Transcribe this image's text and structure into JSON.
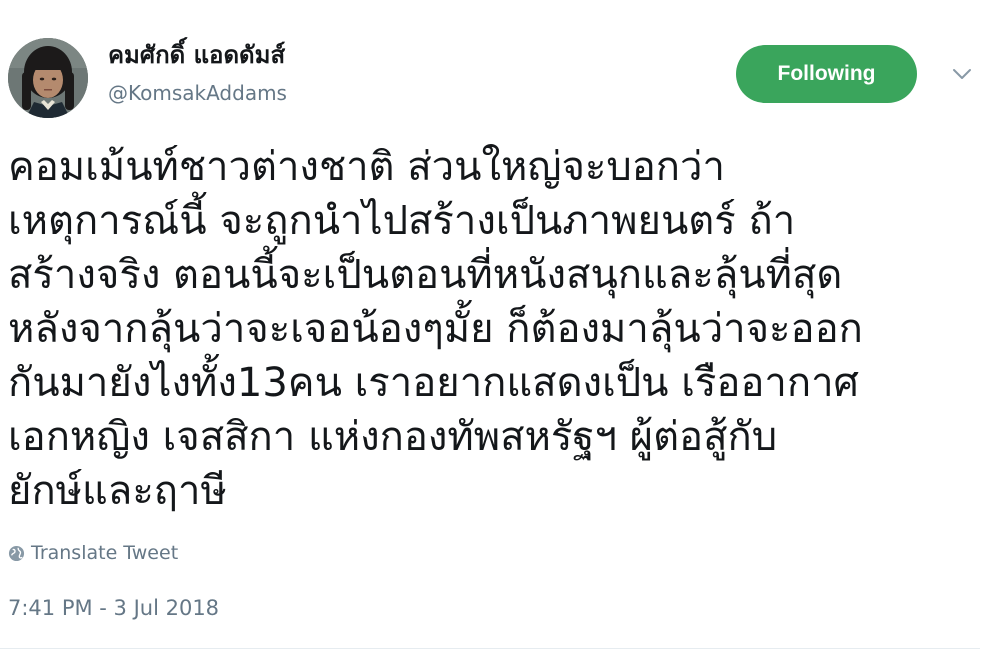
{
  "author": {
    "display_name": "คมศักดิ์ แอดดัมส์",
    "screen_name": "@KomsakAddams",
    "avatar_icon": "profile-photo"
  },
  "follow_button": {
    "label": "Following",
    "color": "#3aa55c"
  },
  "menu": {
    "icon": "chevron-down-icon"
  },
  "tweet": {
    "text": "คอมเม้นท์ชาวต่างชาติ ส่วนใหญ่จะบอกว่า\nเหตุการณ์นี้ จะถูกนำไปสร้างเป็นภาพยนตร์ ถ้า\nสร้างจริง ตอนนี้จะเป็นตอนที่หนังสนุกและลุ้นที่สุด\nหลังจากลุ้นว่าจะเจอน้องๆมั้ย ก็ต้องมาลุ้นว่าจะออก\nกันมายังไงทั้ง13คน เราอยากแสดงเป็น เรืออากาศ\nเอกหญิง เจสสิกา แห่งกองทัพสหรัฐฯ ผู้ต่อสู้กับ\nยักษ์และฤาษี"
  },
  "translate": {
    "label": "Translate Tweet",
    "icon": "globe-icon"
  },
  "timestamp": "7:41 PM - 3 Jul 2018"
}
